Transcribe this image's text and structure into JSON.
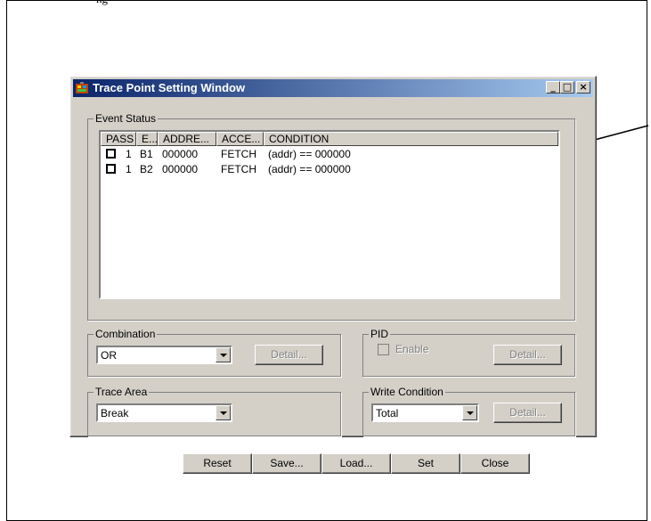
{
  "document": {
    "caption": "ng"
  },
  "window": {
    "title": "Trace Point Setting Window",
    "buttons": {
      "minimize": "_",
      "maximize": "□",
      "close": "×"
    }
  },
  "event_status": {
    "label": "Event Status",
    "columns": [
      "PASS",
      "E...",
      "ADDRE...",
      "ACCE...",
      "CONDITION"
    ],
    "rows": [
      {
        "checked": false,
        "pass": "1",
        "event": "B1",
        "address": "000000",
        "access": "FETCH",
        "condition": "(addr) == 000000"
      },
      {
        "checked": false,
        "pass": "1",
        "event": "B2",
        "address": "000000",
        "access": "FETCH",
        "condition": "(addr) == 000000"
      }
    ]
  },
  "combination": {
    "label": "Combination",
    "value": "OR",
    "detail": "Detail..."
  },
  "pid": {
    "label": "PID",
    "enable": "Enable",
    "detail": "Detail..."
  },
  "trace_area": {
    "label": "Trace Area",
    "value": "Break"
  },
  "write_condition": {
    "label": "Write Condition",
    "value": "Total",
    "detail": "Detail..."
  },
  "footer": {
    "reset": "Reset",
    "save": "Save...",
    "load": "Load...",
    "set": "Set",
    "close": "Close"
  }
}
